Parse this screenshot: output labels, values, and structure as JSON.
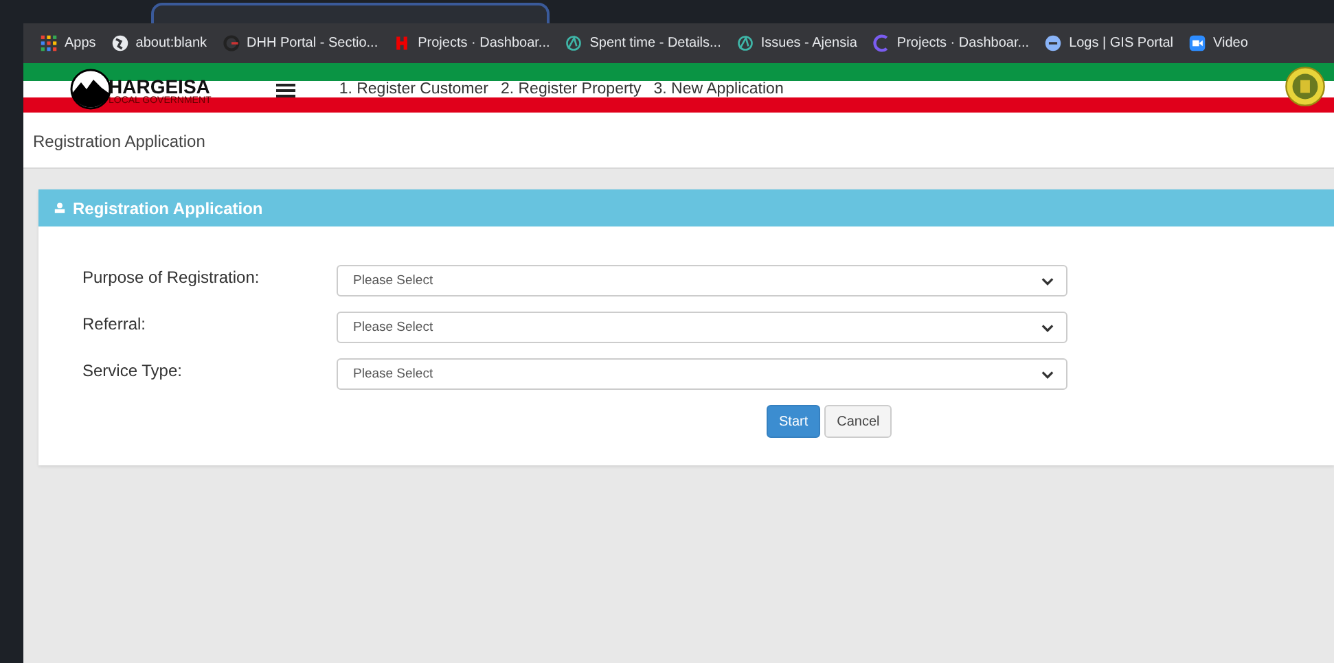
{
  "bookmarks": [
    {
      "label": "Apps"
    },
    {
      "label": "about:blank"
    },
    {
      "label": "DHH Portal - Sectio..."
    },
    {
      "label": "Projects · Dashboar..."
    },
    {
      "label": "Spent time - Details..."
    },
    {
      "label": "Issues - Ajensia"
    },
    {
      "label": "Projects · Dashboar..."
    },
    {
      "label": "Logs | GIS Portal"
    },
    {
      "label": "Video"
    }
  ],
  "header": {
    "logo_title": "HARGEISA",
    "logo_subtitle": "LOCAL GOVERNMENT",
    "steps": [
      "1. Register Customer",
      "2. Register Property",
      "3. New Application"
    ]
  },
  "page_title": "Registration Application",
  "panel": {
    "title": "Registration Application",
    "fields": [
      {
        "label": "Purpose of Registration:",
        "placeholder": "Please Select"
      },
      {
        "label": "Referral:",
        "placeholder": "Please Select"
      },
      {
        "label": "Service Type:",
        "placeholder": "Please Select"
      }
    ],
    "buttons": [
      {
        "label": "Start",
        "kind": "primary"
      },
      {
        "label": "Cancel",
        "kind": "default"
      }
    ]
  }
}
